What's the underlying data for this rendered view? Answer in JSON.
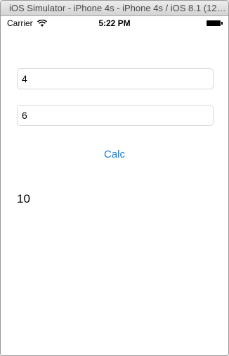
{
  "window": {
    "title": "iOS Simulator - iPhone 4s - iPhone 4s / iOS 8.1 (12B411)"
  },
  "status_bar": {
    "carrier": "Carrier",
    "time": "5:22 PM"
  },
  "form": {
    "input1_value": "4",
    "input2_value": "6",
    "calc_label": "Calc",
    "result": "10"
  },
  "colors": {
    "accent": "#1a7ad6"
  },
  "icons": [
    "wifi-icon",
    "battery-icon"
  ]
}
